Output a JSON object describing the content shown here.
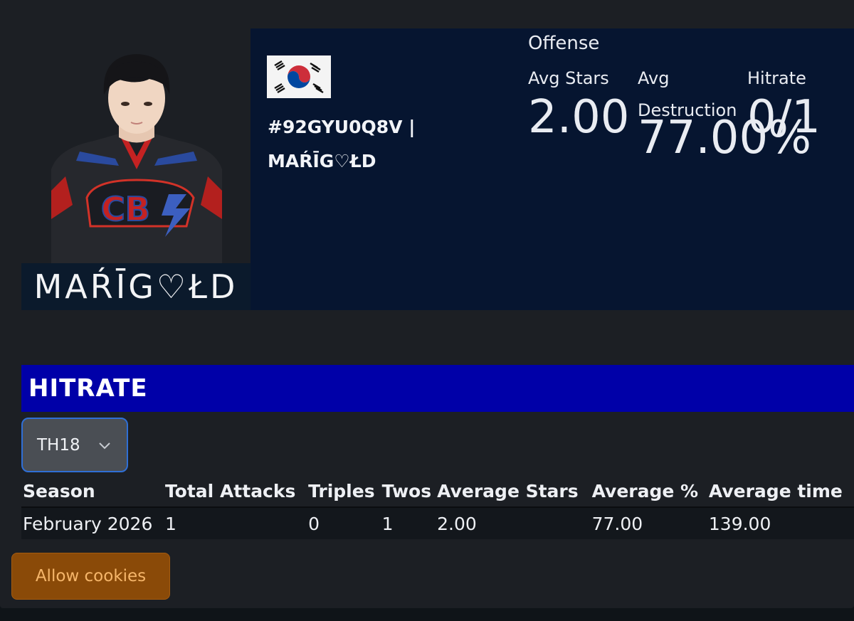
{
  "profile": {
    "photo_name": "MAŔĪG♡ŁD",
    "flag_icon": "south-korea-flag-icon",
    "tag": "#92GYU0Q8V |",
    "player_name": "MAŔĪG♡ŁD"
  },
  "offense": {
    "title": "Offense",
    "avg_stars_label": "Avg Stars",
    "avg_stars_value": "2.00",
    "avg_destruction_label_1": "Avg",
    "avg_destruction_label_2": "Destruction",
    "avg_destruction_value": "77.00%",
    "hitrate_label": "Hitrate",
    "hitrate_value": "0/1"
  },
  "hitrate_section": {
    "title": "HITRATE",
    "th_select_value": "TH18",
    "columns": [
      "Season",
      "Total Attacks",
      "Triples",
      "Twos",
      "Average Stars",
      "Average %",
      "Average time"
    ],
    "rows": [
      [
        "February 2026",
        "1",
        "0",
        "1",
        "2.00",
        "77.00",
        "139.00"
      ]
    ]
  },
  "cookies": {
    "button_label": "Allow cookies"
  },
  "colors": {
    "card_bg": "#061530",
    "section_bar": "#0000a8",
    "select_border": "#2f6fd6",
    "cookies_bg": "#8a4a08"
  }
}
